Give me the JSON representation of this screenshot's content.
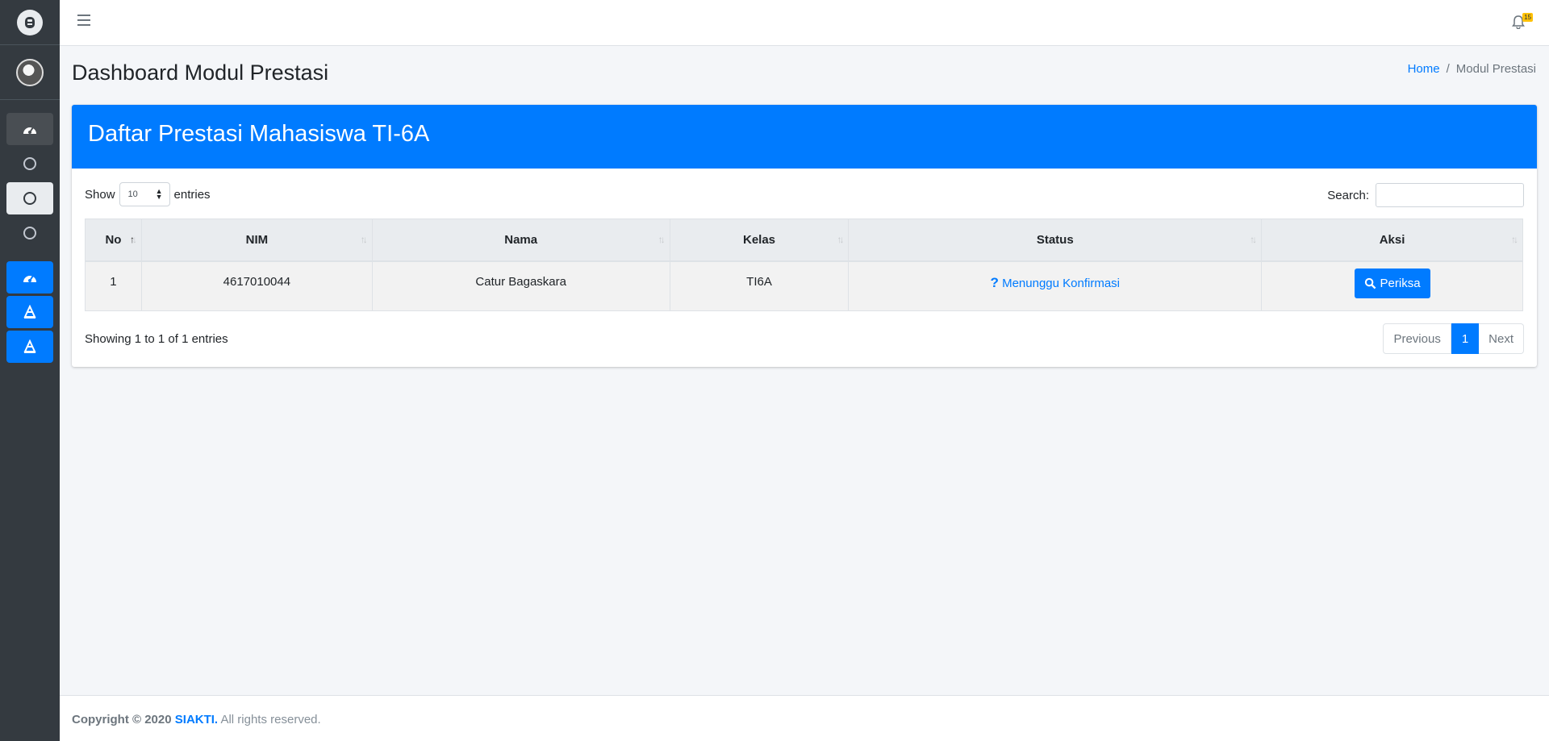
{
  "header": {
    "notification_count": "15"
  },
  "page": {
    "title": "Dashboard Modul Prestasi",
    "breadcrumb": [
      "Home",
      "Modul Prestasi"
    ]
  },
  "sidebar": {
    "icons": [
      "brand-logo",
      "avatar",
      "dashboard-icon",
      "circle-icon",
      "circle-icon",
      "circle-icon",
      "dashboard-icon",
      "trophy-icon",
      "trophy-icon"
    ]
  },
  "card": {
    "title": "Daftar Prestasi Mahasiswa TI-6A",
    "show_label": "Show",
    "entries_value": "10",
    "entries_label": "entries",
    "search_label": "Search:",
    "columns": [
      "No",
      "NIM",
      "Nama",
      "Kelas",
      "Status",
      "Aksi"
    ],
    "rows": [
      {
        "no": "1",
        "nim": "4617010044",
        "nama": "Catur Bagaskara",
        "kelas": "TI6A",
        "status": "Menunggu Konfirmasi",
        "action": "Periksa"
      }
    ],
    "info": "Showing 1 to 1 of 1 entries",
    "pagination": {
      "previous": "Previous",
      "current": "1",
      "next": "Next"
    }
  },
  "footer": {
    "copyright": "Copyright © 2020",
    "brand": "SIAKTI.",
    "rights": "All rights reserved."
  },
  "colors": {
    "primary": "#007bff",
    "sidebar": "#343a40",
    "badge": "#ffc107"
  }
}
